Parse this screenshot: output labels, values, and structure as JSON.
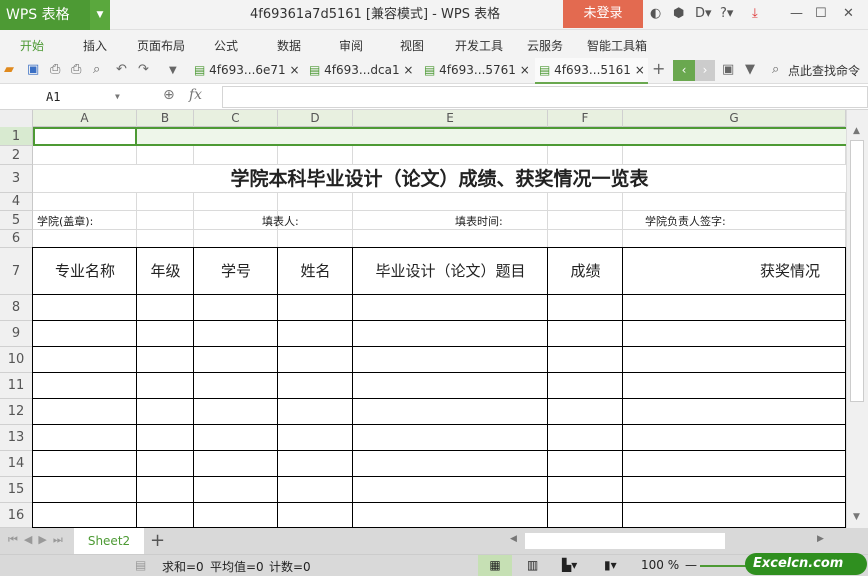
{
  "app": {
    "logo": "WPS 表格",
    "title": "4f69361a7d5161 [兼容模式] - WPS 表格",
    "login": "未登录"
  },
  "menu": [
    "开始",
    "插入",
    "页面布局",
    "公式",
    "数据",
    "审阅",
    "视图",
    "开发工具",
    "云服务",
    "智能工具箱"
  ],
  "doc_tabs": [
    {
      "label": "4f693...6e71"
    },
    {
      "label": "4f693...dca1"
    },
    {
      "label": "4f693...5761"
    },
    {
      "label": "4f693...5161"
    }
  ],
  "search_cmd": "点此查找命令",
  "formula": {
    "cell_ref": "A1",
    "fx": "fx",
    "value": ""
  },
  "columns": [
    "A",
    "B",
    "C",
    "D",
    "E",
    "F",
    "G"
  ],
  "rows": [
    "1",
    "2",
    "3",
    "4",
    "5",
    "6",
    "7",
    "8",
    "9",
    "10",
    "11",
    "12",
    "13",
    "14",
    "15",
    "16"
  ],
  "sheet": {
    "title": "学院本科毕业设计（论文）成绩、获奖情况一览表",
    "row5": [
      "学院(盖章):",
      "填表人:",
      "填表时间:",
      "学院负责人签字:"
    ],
    "headers": [
      "专业名称",
      "年级",
      "学号",
      "姓名",
      "毕业设计（论文）题目",
      "成绩",
      "获奖情况"
    ]
  },
  "sheet_tabs": [
    "Sheet2"
  ],
  "status": {
    "sum": "求和=0",
    "avg": "平均值=0",
    "count": "计数=0",
    "zoom": "100 %"
  },
  "watermark": "Excelcn.com",
  "colors": {
    "accent": "#4d9a34",
    "login": "#e36a50"
  }
}
